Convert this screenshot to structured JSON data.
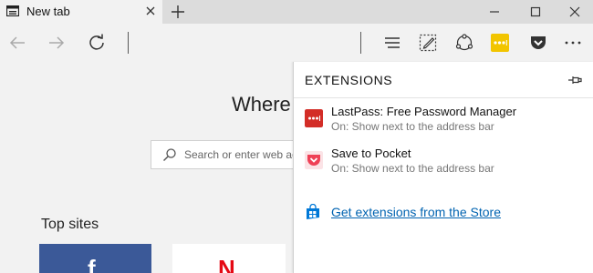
{
  "tab": {
    "title": "New tab"
  },
  "page": {
    "heading_partial": "Where",
    "search_placeholder": "Search or enter web ad",
    "top_sites_label": "Top sites",
    "tiles": [
      {
        "glyph": "f",
        "color": "#3b5998"
      },
      {
        "glyph": "N",
        "color": "#e50914"
      }
    ]
  },
  "extensions_panel": {
    "title": "EXTENSIONS",
    "items": [
      {
        "name": "LastPass: Free Password Manager",
        "status": "On: Show next to the address bar",
        "icon": "lastpass-icon",
        "color": "#d32d27"
      },
      {
        "name": "Save to Pocket",
        "status": "On: Show next to the address bar",
        "icon": "pocket-icon",
        "color": "#ef4056"
      }
    ],
    "store_link": "Get extensions from the Store"
  },
  "colors": {
    "accent": "#0063b1",
    "lastpass_toolbar": "#f2c500"
  }
}
